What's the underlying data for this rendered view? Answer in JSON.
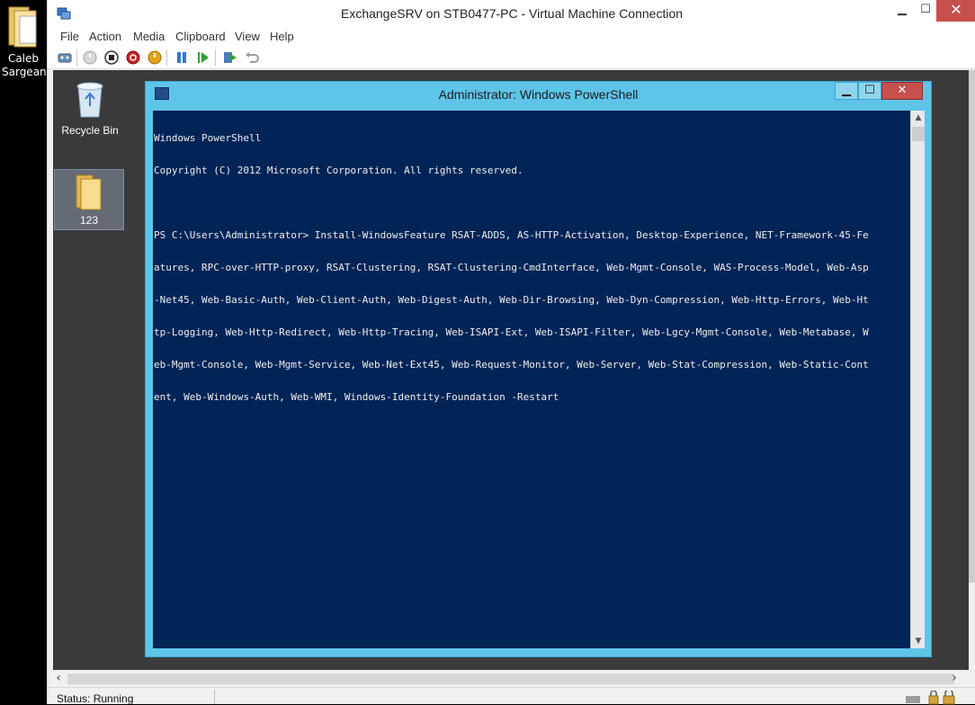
{
  "host": {
    "desktop_icon_label_line1": "Caleb",
    "desktop_icon_label_line2": "Sargeant"
  },
  "window": {
    "title": "ExchangeSRV on STB0477-PC - Virtual Machine Connection",
    "minimize_glyph": "▁",
    "maximize_glyph": "☐",
    "close_glyph": "✕"
  },
  "menu": {
    "items": [
      "File",
      "Action",
      "Media",
      "Clipboard",
      "View",
      "Help"
    ]
  },
  "toolbar": {
    "buttons": [
      "ctrl-alt-del-icon",
      "start-icon",
      "turn-off-icon",
      "shutdown-icon",
      "save-icon",
      "pause-icon",
      "resume-icon",
      "checkpoint-icon",
      "revert-icon"
    ]
  },
  "guest_desktop": {
    "recycle_bin_label": "Recycle Bin",
    "folder_label": "123"
  },
  "powershell": {
    "title": "Administrator: Windows PowerShell",
    "lines": [
      "Windows PowerShell",
      "Copyright (C) 2012 Microsoft Corporation. All rights reserved.",
      "",
      "PS C:\\Users\\Administrator> Install-WindowsFeature RSAT-ADDS, AS-HTTP-Activation, Desktop-Experience, NET-Framework-45-Fe",
      "atures, RPC-over-HTTP-proxy, RSAT-Clustering, RSAT-Clustering-CmdInterface, Web-Mgmt-Console, WAS-Process-Model, Web-Asp",
      "-Net45, Web-Basic-Auth, Web-Client-Auth, Web-Digest-Auth, Web-Dir-Browsing, Web-Dyn-Compression, Web-Http-Errors, Web-Ht",
      "tp-Logging, Web-Http-Redirect, Web-Http-Tracing, Web-ISAPI-Ext, Web-ISAPI-Filter, Web-Lgcy-Mgmt-Console, Web-Metabase, W",
      "eb-Mgmt-Console, Web-Mgmt-Service, Web-Net-Ext45, Web-Request-Monitor, Web-Server, Web-Stat-Compression, Web-Static-Cont",
      "ent, Web-Windows-Auth, Web-WMI, Windows-Identity-Foundation -Restart"
    ]
  },
  "status": {
    "text": "Status: Running"
  },
  "colors": {
    "console_bg": "#012456",
    "ps_frame": "#5ec4e8",
    "close_red": "#c7504c"
  }
}
